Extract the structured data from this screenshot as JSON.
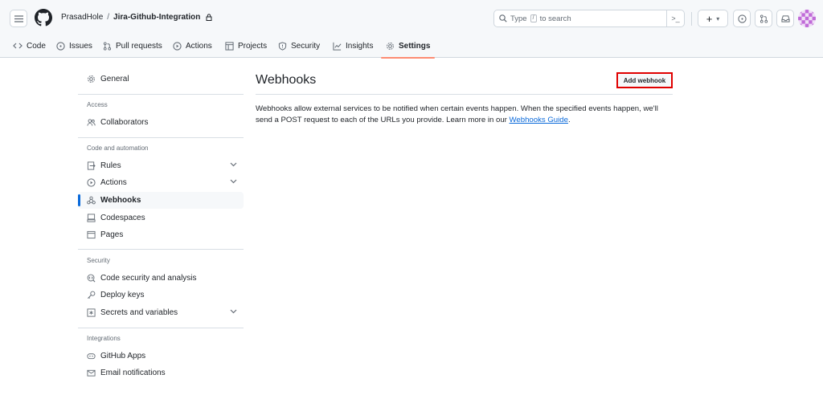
{
  "header": {
    "owner": "PrasadHole",
    "separator": "/",
    "repo": "Jira-Github-Integration",
    "search_prefix": "Type",
    "search_key": "/",
    "search_suffix": "to search",
    "cmd_glyph": ">_",
    "plus_glyph": "+",
    "caret_glyph": "▾"
  },
  "tabs": [
    {
      "label": "Code",
      "icon": "code-icon"
    },
    {
      "label": "Issues",
      "icon": "issue-icon"
    },
    {
      "label": "Pull requests",
      "icon": "pull-request-icon"
    },
    {
      "label": "Actions",
      "icon": "play-icon"
    },
    {
      "label": "Projects",
      "icon": "table-icon"
    },
    {
      "label": "Security",
      "icon": "shield-icon"
    },
    {
      "label": "Insights",
      "icon": "graph-icon"
    },
    {
      "label": "Settings",
      "icon": "gear-icon",
      "active": true
    }
  ],
  "sidebar": {
    "general": "General",
    "access_heading": "Access",
    "collaborators": "Collaborators",
    "code_heading": "Code and automation",
    "rules": "Rules",
    "actions": "Actions",
    "webhooks": "Webhooks",
    "codespaces": "Codespaces",
    "pages": "Pages",
    "security_heading": "Security",
    "code_security": "Code security and analysis",
    "deploy_keys": "Deploy keys",
    "secrets": "Secrets and variables",
    "integrations_heading": "Integrations",
    "github_apps": "GitHub Apps",
    "email_notifications": "Email notifications"
  },
  "main": {
    "title": "Webhooks",
    "add_button": "Add webhook",
    "desc_before": "Webhooks allow external services to be notified when certain events happen. When the specified events happen, we'll send a POST request to each of the URLs you provide. Learn more in our ",
    "desc_link": "Webhooks Guide",
    "desc_after": "."
  },
  "colors": {
    "accent_blue": "#0969da",
    "tab_underline": "#fd8c73",
    "highlight_red": "#e00000"
  }
}
